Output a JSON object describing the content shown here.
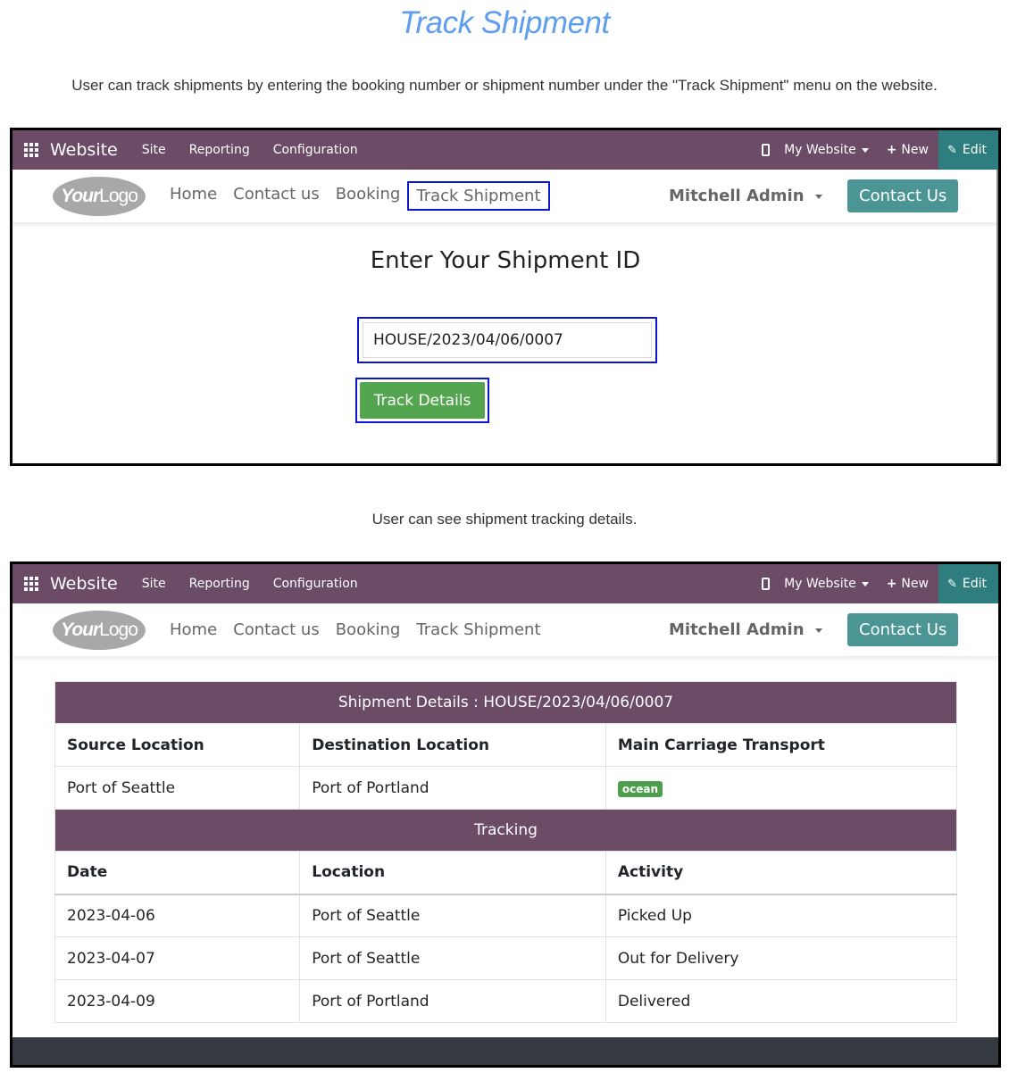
{
  "title": "Track Shipment",
  "caption_1": "User can track shipments by entering the booking number or shipment number under the \"Track Shipment\" menu on the website.",
  "caption_2": "User can see shipment tracking details.",
  "admin_bar": {
    "brand": "Website",
    "menus": [
      "Site",
      "Reporting",
      "Configuration"
    ],
    "my_website": "My Website",
    "new": "New",
    "edit": "Edit"
  },
  "navbar": {
    "logo_bold": "Your",
    "logo_light": "Logo",
    "links": [
      "Home",
      "Contact us",
      "Booking",
      "Track Shipment"
    ],
    "user": "Mitchell Admin",
    "contact_button": "Contact Us"
  },
  "form": {
    "heading": "Enter Your Shipment ID",
    "shipment_id": "HOUSE/2023/04/06/0007",
    "button": "Track Details"
  },
  "details": {
    "header": "Shipment Details : HOUSE/2023/04/06/0007",
    "columns": [
      "Source Location",
      "Destination Location",
      "Main Carriage Transport"
    ],
    "values": [
      "Port of Seattle",
      "Port of Portland",
      "ocean"
    ],
    "tracking_header": "Tracking",
    "tracking_columns": [
      "Date",
      "Location",
      "Activity"
    ],
    "tracking_rows": [
      [
        "2023-04-06",
        "Port of Seattle",
        "Picked Up"
      ],
      [
        "2023-04-07",
        "Port of Seattle",
        "Out for Delivery"
      ],
      [
        "2023-04-09",
        "Port of Portland",
        "Delivered"
      ]
    ]
  },
  "colors": {
    "admin_bar": "#6b4b66",
    "edit_button": "#2e7e7f",
    "contact_button": "#4b9595",
    "track_button": "#53a54f",
    "highlight_border": "#0b15d8",
    "title": "#5f9ded"
  }
}
